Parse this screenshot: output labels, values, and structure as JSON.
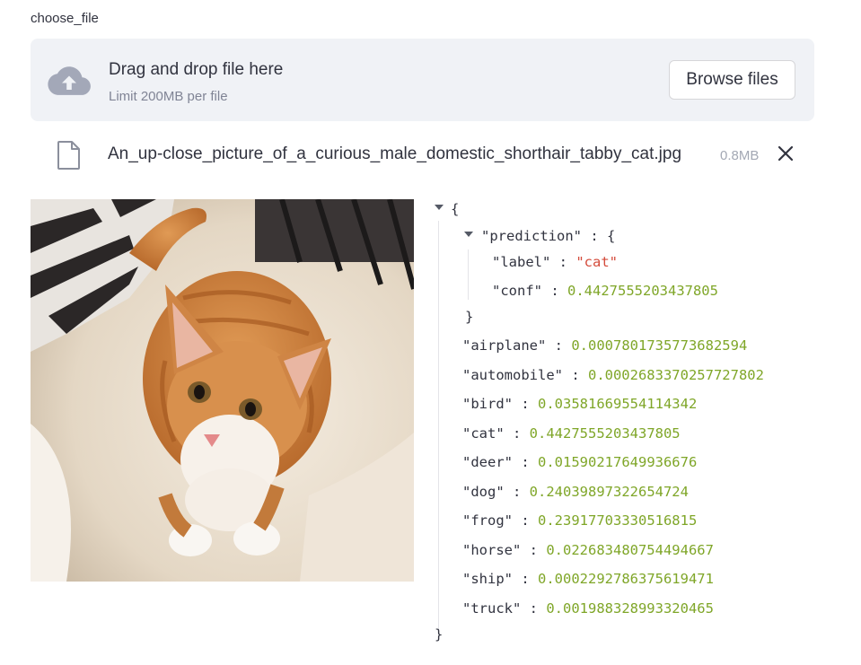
{
  "uploader": {
    "label": "choose_file",
    "drop_title": "Drag and drop file here",
    "drop_subtitle": "Limit 200MB per file",
    "browse_label": "Browse files",
    "upload_icon": "cloud-upload-icon"
  },
  "file": {
    "name": "An_up-close_picture_of_a_curious_male_domestic_shorthair_tabby_cat.jpg",
    "size": "0.8MB",
    "file_icon": "file-icon",
    "remove_icon": "close-icon"
  },
  "image": {
    "subject": "orange tabby kitten on a bed"
  },
  "json_view": {
    "open_brace": "{",
    "close_brace": "}",
    "prediction": {
      "key": "\"prediction\"",
      "label_key": "\"label\"",
      "label_value": "\"cat\"",
      "conf_key": "\"conf\"",
      "conf_value": "0.4427555203437805"
    },
    "scores": [
      {
        "key": "\"airplane\"",
        "value": "0.0007801735773682594"
      },
      {
        "key": "\"automobile\"",
        "value": "0.0002683370257727802"
      },
      {
        "key": "\"bird\"",
        "value": "0.03581669554114342"
      },
      {
        "key": "\"cat\"",
        "value": "0.4427555203437805"
      },
      {
        "key": "\"deer\"",
        "value": "0.01590217649936676"
      },
      {
        "key": "\"dog\"",
        "value": "0.24039897322654724"
      },
      {
        "key": "\"frog\"",
        "value": "0.23917703330516815"
      },
      {
        "key": "\"horse\"",
        "value": "0.022683480754494667"
      },
      {
        "key": "\"ship\"",
        "value": "0.0002292786375619471"
      },
      {
        "key": "\"truck\"",
        "value": "0.001988328993320465"
      }
    ]
  },
  "colors": {
    "dropzone_bg": "#f0f2f6",
    "number": "#7fa628",
    "string": "#d44c3c",
    "text": "#31333f"
  }
}
